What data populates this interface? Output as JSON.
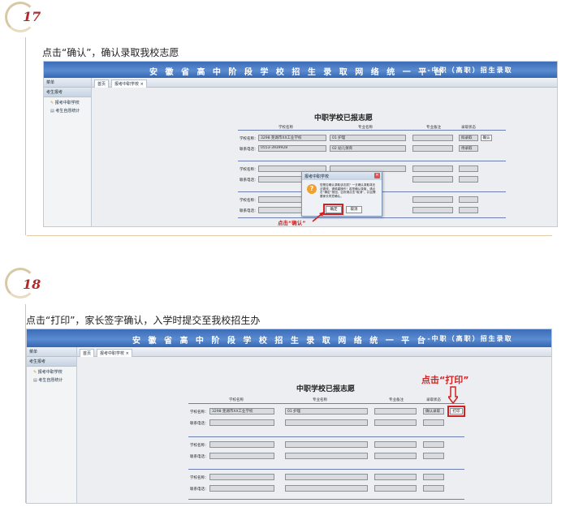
{
  "steps": [
    {
      "number": "17",
      "caption": "点击“确认”，确认录取我校志愿",
      "banner_title": "安 徽 省 高 中 阶 段 学 校 招 生 录 取 网 络 统 一 平 台",
      "banner_sub": "--中职（高职）招生录取",
      "sidebar_header": "菜单",
      "sidebar_group": "考生报考",
      "sidebar_items": [
        "报考中职学校",
        "考生自愿统计"
      ],
      "tabs": [
        "首页",
        "报考中职学校 ×"
      ],
      "form_title": "中职学校已报志愿",
      "col_headers": [
        "学校名称",
        "专业名称",
        "专业备注",
        "录取状态"
      ],
      "row_labels": [
        "学校名称：",
        "联系电话："
      ],
      "school_value": "3298 芜湖市XX工业学校",
      "major_value": "01 护理",
      "phone_value": "0553-3939928",
      "major2_value": "02 幼儿保育",
      "status_value": "拟录取",
      "status2_value": "待录取",
      "confirm_link": "确认",
      "dialog_title": "报考中职学校",
      "dialog_message": "您是否确认录取该志愿？一旦确认录取将无法更改，请慎重操作！若您确认录取，请点击“确定”按钮，否则请点击“取消”，并且需要家长同意确认。",
      "dialog_ok": "确定",
      "dialog_cancel": "取消",
      "annotation": "点击“确认”"
    },
    {
      "number": "18",
      "caption": "点击“打印”，家长签字确认，入学时提交至我校招生办",
      "banner_title": "安 徽 省 高 中 阶 段 学 校 招 生 录 取 网 络 统 一 平 台",
      "banner_sub": "--中职（高职）招生录取",
      "sidebar_header": "菜单",
      "sidebar_group": "考生报考",
      "sidebar_items": [
        "报考中职学校",
        "考生自愿统计"
      ],
      "tabs": [
        "首页",
        "报考中职学校 ×"
      ],
      "form_title": "中职学校已报志愿",
      "col_headers": [
        "学校名称",
        "专业名称",
        "专业备注",
        "录取状态"
      ],
      "row_labels": [
        "学校名称：",
        "联系电话："
      ],
      "school_value": "3298 芜湖市XX工业学校",
      "major_value": "01 护理",
      "status_value": "确认录取",
      "print_button": "打印",
      "annotation": "点击“打印”"
    }
  ],
  "colors": {
    "accent_red": "#d32020",
    "banner_blue": "#4a7cc4",
    "step_number": "#b02a2a"
  }
}
